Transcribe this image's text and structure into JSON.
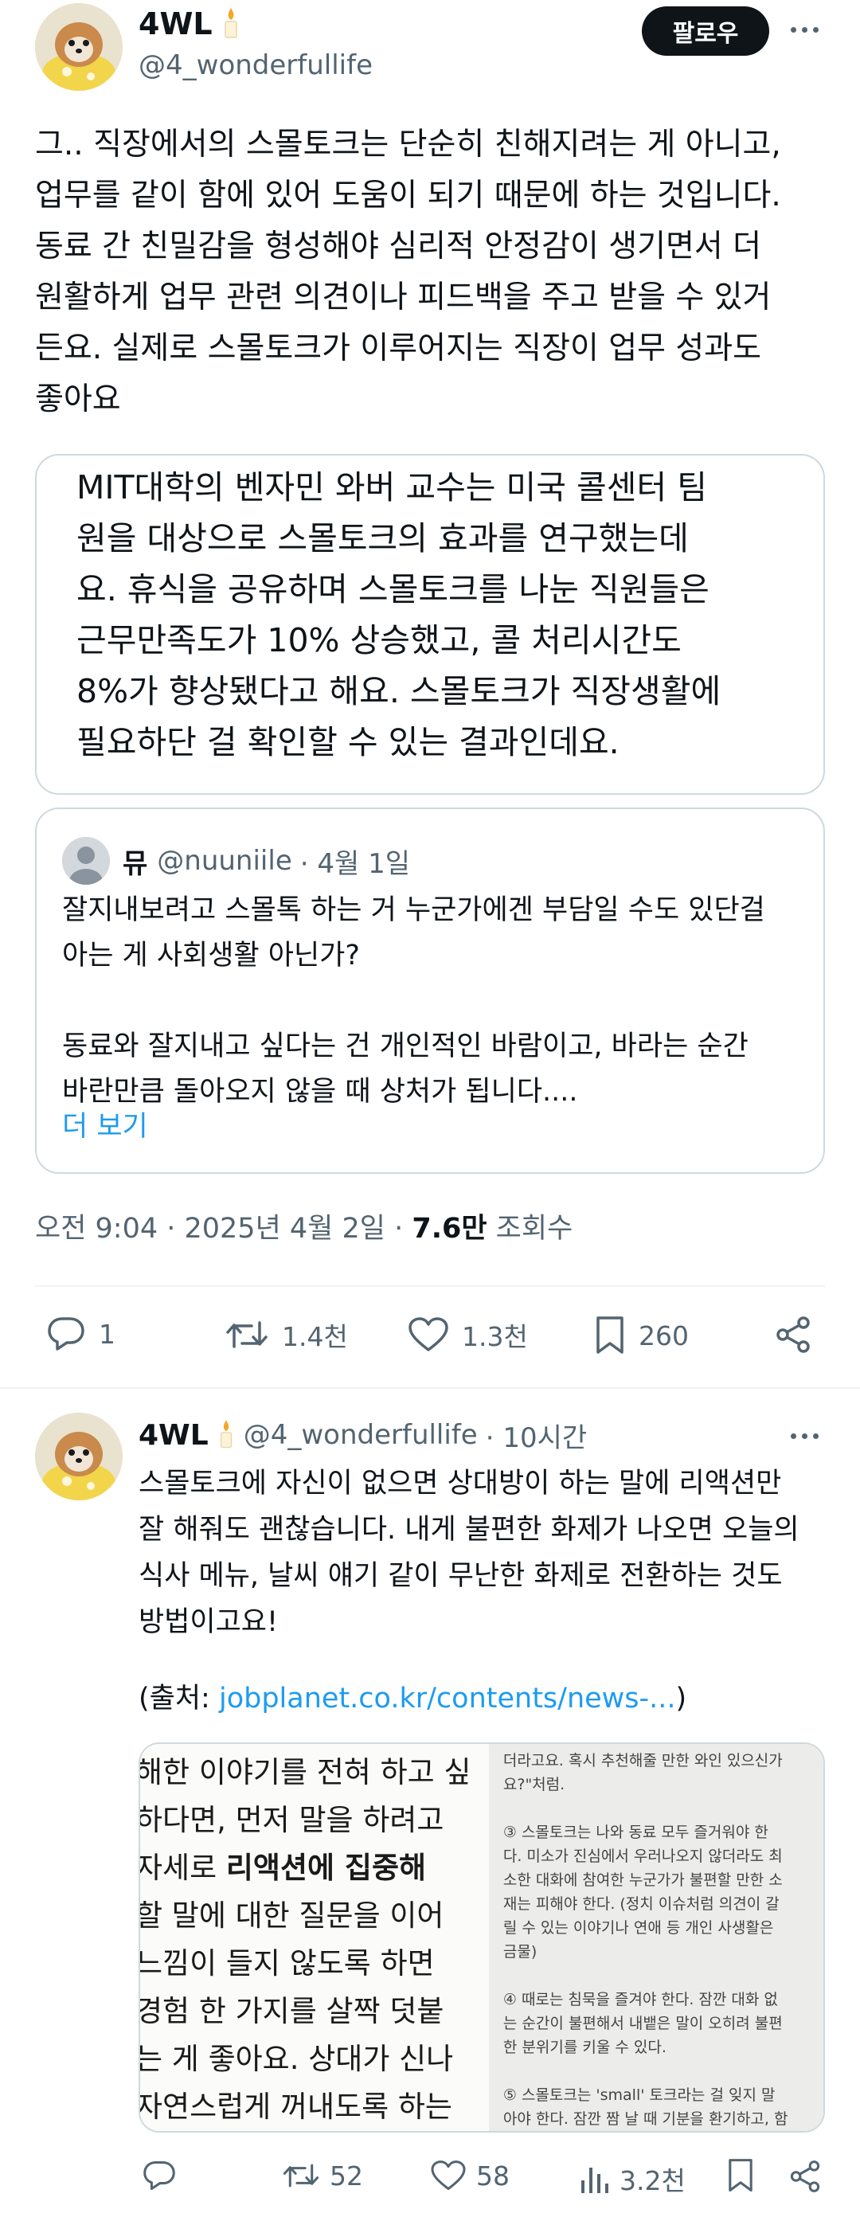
{
  "tweet": {
    "author_name": "4WL",
    "author_handle": "@4_wonderfullife",
    "follow_label": "팔로우",
    "text": "그.. 직장에서의 스몰토크는 단순히 친해지려는 게 아니고,\n업무를 같이 함에 있어 도움이 되기 때문에 하는 것입니다.\n동료 간 친밀감을 형성해야 심리적 안정감이 생기면서 더\n원활하게 업무 관련 의견이나 피드백을 주고 받을 수 있거\n든요. 실제로 스몰토크가 이루어지는 직장이 업무 성과도\n좋아요",
    "card_text": "MIT대학의 벤자민 와버 교수는 미국 콜센터 팀\n원을 대상으로 스몰토크의 효과를 연구했는데\n요. 휴식을 공유하며 스몰토크를 나눈 직원들은\n근무만족도가 10% 상승했고, 콜 처리시간도\n8%가 향상됐다고 해요. 스몰토크가 직장생활에\n필요하단 걸 확인할 수 있는 결과인데요.",
    "quote": {
      "name": "뮤",
      "handle": "@nuuniile",
      "date": "· 4월 1일",
      "text": "잘지내보려고 스몰톡 하는 거 누군가에겐 부담일 수도 있단걸\n아는 게 사회생활 아닌가?\n\n동료와 잘지내고 싶다는 건 개인적인 바람이고, 바라는 순간\n바란만큼 돌아오지 않을 때 상처가 됩니다....",
      "show_more": "더 보기"
    },
    "timestamp": "오전 9:04 · 2025년 4월 2일 · ",
    "views_count": "7.6만",
    "views_label": " 조회수",
    "actions": {
      "replies": "1",
      "retweets": "1.4천",
      "likes": "1.3천",
      "bookmarks": "260"
    }
  },
  "reply": {
    "author_name": "4WL",
    "author_handle": "@4_wonderfullife",
    "time": "· 10시간",
    "text": "스몰토크에 자신이 없으면 상대방이 하는 말에 리액션만\n잘 해줘도 괜찮습니다. 내게 불편한 화제가 나오면 오늘의\n식사 메뉴, 날씨 얘기 같이 무난한 화제로 전환하는 것도\n방법이고요!",
    "source_prefix": "(출처: ",
    "source_link": "jobplanet.co.kr/contents/news-...",
    "source_suffix": ")",
    "media_left_lines": [
      "해한 이야기를 전혀 하고 싶",
      "하다면, 먼저 말을 하려고 ",
      "자세로 리액션에 집중해",
      "할 말에 대한 질문을 이어",
      "느낌이 들지 않도록 하면",
      "경험 한 가지를 살짝 덧붙",
      "는 게 좋아요. 상대가 신나",
      "자연스럽게 꺼내도록 하는"
    ],
    "media_right_text": "더라고요. 혹시 추천해줄 만한 와인 있으신가\n요?\"처럼.\n\n③ 스몰토크는 나와 동료 모두 즐거워야 한\n다. 미소가 진심에서 우러나오지 않더라도 최\n소한 대화에 참여한 누군가가 불편할 만한 소\n재는 피해야 한다. (정치 이슈처럼 의견이 갈\n릴 수 있는 이야기나 연애 등 개인 사생활은\n금물)\n\n④ 때로는 침묵을 즐겨야 한다. 잠깐 대화 없\n는 순간이 불편해서 내뱉은 말이 오히려 불편\n한 분위기를 키울 수 있다.\n\n⑤ 스몰토크는 'small' 토크라는 걸 잊지 말\n아야 한다. 잠깐 짬 날 때 기분을 환기하고, 함\n께 일하는 관계에 있어서 윤활유 역할을 해주\n는 데 그쳐야 한다. 일이 방해될 정도의 '뇌",
    "actions": {
      "retweets": "52",
      "likes": "58",
      "views": "3.2천"
    }
  }
}
